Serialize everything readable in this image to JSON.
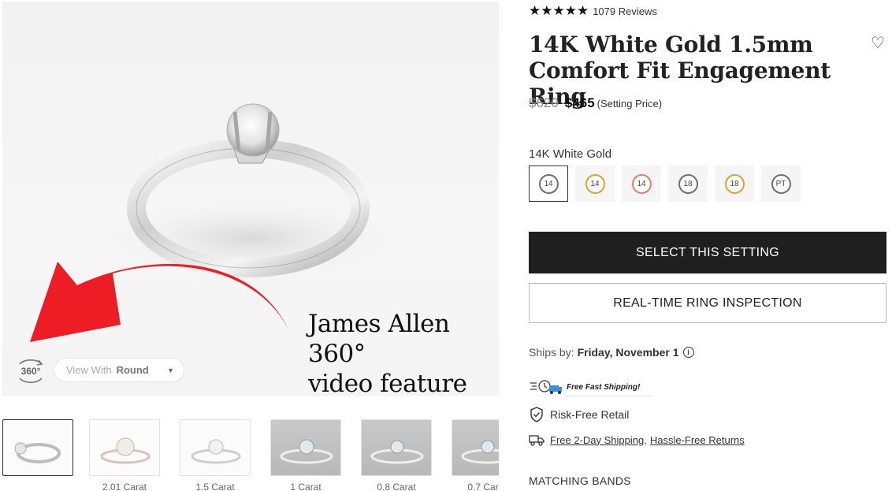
{
  "gallery": {
    "annotation_line1": "James Allen 360°",
    "annotation_line2": "video feature",
    "icon_360_label": "360°",
    "view_with_label": "View With",
    "view_with_shape": "Round",
    "thumbnails": [
      {
        "caption": ""
      },
      {
        "caption": "2.01 Carat"
      },
      {
        "caption": "1.5 Carat"
      },
      {
        "caption": "1 Carat"
      },
      {
        "caption": "0.8 Carat"
      },
      {
        "caption": "0.7 Carat"
      }
    ]
  },
  "product": {
    "rating_stars": 5,
    "reviews_label": "1079 Reviews",
    "title": "14K White Gold 1.5mm Comfort Fit Engagement Ring",
    "old_price": "$620",
    "new_price": "$465",
    "price_note": "(Setting Price)",
    "metal_label": "14K White Gold",
    "metals": [
      {
        "label": "14",
        "color": "#6f6f6f"
      },
      {
        "label": "14",
        "color": "#d9a23a"
      },
      {
        "label": "14",
        "color": "#ec7a6e"
      },
      {
        "label": "18",
        "color": "#6f6f6f"
      },
      {
        "label": "18",
        "color": "#d9a23a"
      },
      {
        "label": "PT",
        "color": "#6f6f6f"
      }
    ]
  },
  "actions": {
    "select_label": "SELECT THIS SETTING",
    "inspection_label": "REAL-TIME RING INSPECTION"
  },
  "shipping": {
    "ships_label": "Ships by:",
    "ships_date": "Friday, November 1",
    "info_icon": "i",
    "free_shipping_badge": "Free Fast Shipping!",
    "risk_free": "Risk-Free Retail",
    "two_day": "Free 2-Day Shipping,",
    "returns": "Hassle-Free Returns"
  },
  "matching_bands": "MATCHING BANDS",
  "colors": {
    "primary_button": "#1f1f1f",
    "arrow_red": "#ee1c25"
  }
}
